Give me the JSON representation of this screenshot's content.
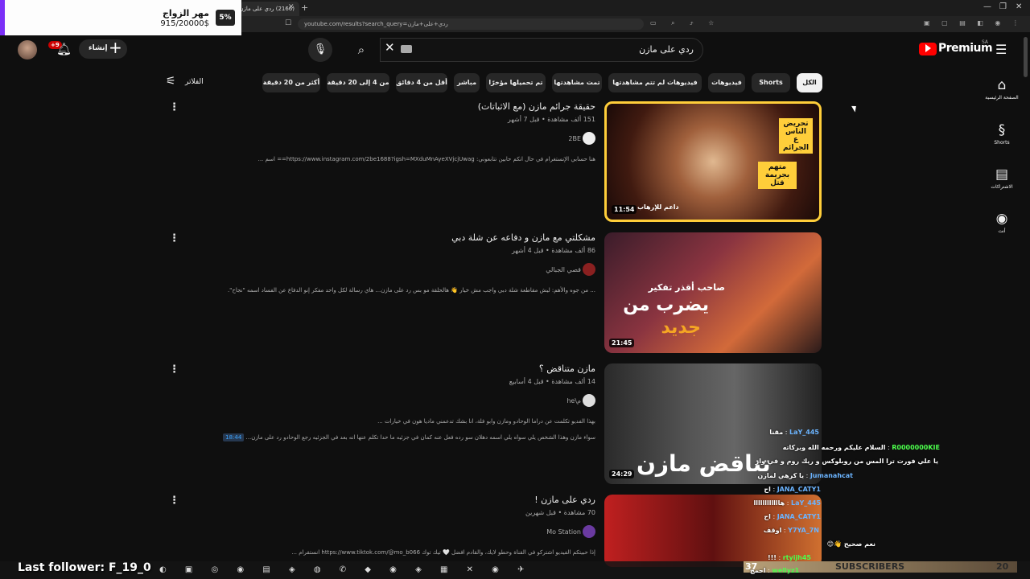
{
  "browser": {
    "tab_title": "(2166) ردي على مازن",
    "url": "youtube.com/results?search_query=ردي+على+مازن",
    "win_controls": [
      "—",
      "❐",
      "✕"
    ]
  },
  "goal_widget": {
    "title": "مهر الزواج",
    "amount": "915/20000$",
    "percent": "5%"
  },
  "header": {
    "notifications": "+9",
    "create_label": "إنشاء",
    "search_query": "ردي على مازن",
    "brand": "Premium",
    "region": "SA"
  },
  "filters_label": "الفلاتر",
  "chips": [
    {
      "label": "الكل",
      "active": true
    },
    {
      "label": "Shorts",
      "active": false
    },
    {
      "label": "فيديوهات",
      "active": false
    },
    {
      "label": "فيديوهات لم تتم مشاهدتها",
      "active": false
    },
    {
      "label": "تمت مشاهدتها",
      "active": false
    },
    {
      "label": "تم تحميلها مؤخرًا",
      "active": false
    },
    {
      "label": "مباشر",
      "active": false
    },
    {
      "label": "أقل من 4 دقائق",
      "active": false
    },
    {
      "label": "من 4 إلى 20 دقيقة",
      "active": false
    },
    {
      "label": "أكثر من 20 دقيقة",
      "active": false
    }
  ],
  "right_nav": [
    {
      "label": "الصفحة الرئيسية",
      "icon": "home-icon"
    },
    {
      "label": "Shorts",
      "icon": "shorts-icon"
    },
    {
      "label": "الاشتراكات",
      "icon": "subscriptions-icon"
    },
    {
      "label": "أنت",
      "icon": "you-icon"
    }
  ],
  "results": [
    {
      "title": "حقيقة جرائم مازن (مع الاثباتات)",
      "meta": "151 ألف مشاهدة • قبل 7 أشهر",
      "channel": "2BE",
      "desc": "هنا حسابي الإنستغرام في حال انكم حابين تتابعوني: https://www.instagram.com/2be1688?igsh=MXduMnAyeXVjcjUwag== اسم ...",
      "desc2": "",
      "timestamp": "",
      "duration": "11:54",
      "thumb_text": [
        "تحريض الناس ع الجرائم",
        "متهم بجريمة قتل",
        "داعم للإرهاب"
      ]
    },
    {
      "title": "مشكلتي مع مازن و دفاعه عن شلة دبي",
      "meta": "86 ألف مشاهدة • قبل 4 أشهر",
      "channel": "قصي الجبالي",
      "desc": "... من جوه والأهم: ليش مقاطعة شلة دبي واجب مش خيار 👋 هالحلقة مو بس رد على مازن... هاي رسالة لكل واحد مفكر إنو الدفاع عن الفساد اسمه \"نجاح\".",
      "desc2": "",
      "timestamp": "",
      "duration": "21:45",
      "thumb_text": [
        "صاحب أقذر تفكير",
        "يضرب من",
        "جديد"
      ]
    },
    {
      "title": "مازن متناقض ؟",
      "meta": "14 ألف مشاهدة • قبل 4 أسابيع",
      "channel": "he\\م",
      "desc": "بهذا الفديو تكلمت عن دراما الوحادو ومازن وابو فلة، انا بشك تدعمني ماديا هون في خيارات ...",
      "desc2": "سواء مازن وهذا الشخص يلي سواه يلي اسمه دهلان سو رده فعل عنه كمان في جزئيه ما حدا تكلم عنها انه بعد في الجزئيه رجع الوحادو رد على مازن...",
      "timestamp": "18:44",
      "duration": "24:29",
      "thumb_text": [
        "تناقض مازن"
      ]
    },
    {
      "title": "ردي على مازن !",
      "meta": "70 مشاهدة • قبل شهرين",
      "channel": "Mo Station",
      "desc": "إذا حبيتكم الفيديو اشتركو في القناة وحطو لايك، والقادم افضل 🤍 تيك توك https://www.tiktok.com/@mo_b066 انستقرام ...",
      "desc2": "",
      "timestamp": "",
      "duration": "",
      "thumb_text": []
    }
  ],
  "chat": [
    {
      "name": "LaY_445",
      "msg": "مقنا"
    },
    {
      "name": "R0000000KIE",
      "msg": "السلام عليكم ورحمه الله وبركاته"
    },
    {
      "name": "",
      "msg": "يا علي فورت ترا المس من روبلوكس و ريك روم و في وار"
    },
    {
      "name": "Jumanahcat",
      "msg": "يا كرهي لمازن"
    },
    {
      "name": "JANA_CATY1",
      "msg": "اح"
    },
    {
      "name": "LaY_445",
      "msg": "هاااااااااااا"
    },
    {
      "name": "JANA_CATY1",
      "msg": "اح"
    },
    {
      "name": "Y7YA_7N",
      "msg": "اوقف"
    },
    {
      "name": "",
      "msg": "نعم صحيح 👋😊"
    },
    {
      "name": "rtyijh45",
      "msg": "!!!"
    },
    {
      "name": "wellyz1",
      "msg": "احمج"
    }
  ],
  "stream_overlay": {
    "last_follower": "Last follower: F_19_0",
    "subscribers_label": "SUBSCRIBERS",
    "subscribers_count": "20",
    "subs_left": "37"
  }
}
